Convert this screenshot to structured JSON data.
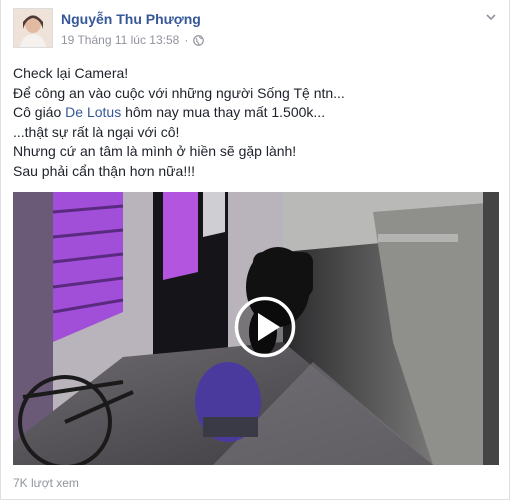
{
  "post": {
    "author": "Nguyễn Thu Phượng",
    "timestamp": "19 Tháng 11 lúc 13:58",
    "privacy_icon": "globe-icon",
    "menu_icon": "chevron-down-icon",
    "lines": [
      "Check lại Camera!",
      "Để công an vào cuộc với những người Sống Tệ ntn...",
      "",
      "...thật sự rất là ngại với cô!",
      "Nhưng cứ an tâm là mình ở hiền sẽ gặp lành!",
      "Sau phải cẩn thận hơn nữa!!!"
    ],
    "line3_prefix": "Cô giáo ",
    "line3_link": "De Lotus",
    "line3_suffix": " hôm nay mua thay mất 1.500k...",
    "video": {
      "play_icon": "play-icon"
    },
    "views": "7K lượt xem"
  },
  "colors": {
    "link": "#365899",
    "meta": "#90949c",
    "text": "#1d2129"
  }
}
